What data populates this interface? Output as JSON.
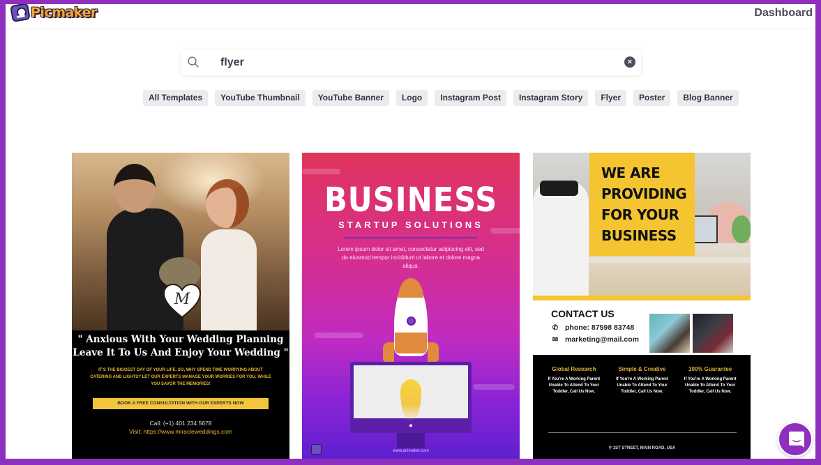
{
  "app": {
    "logo_text": "Picmaker",
    "frame_color": "#8e2fbf"
  },
  "header": {
    "dashboard_label": "Dashboard"
  },
  "search": {
    "value": "flyer",
    "placeholder": "",
    "clear_icon": "clear-circle-icon",
    "search_icon": "search-icon"
  },
  "categories": [
    {
      "label": "All Templates"
    },
    {
      "label": "YouTube Thumbnail"
    },
    {
      "label": "YouTube Banner"
    },
    {
      "label": "Logo"
    },
    {
      "label": "Instagram Post"
    },
    {
      "label": "Instagram Story"
    },
    {
      "label": "Flyer"
    },
    {
      "label": "Poster"
    },
    {
      "label": "Blog Banner"
    }
  ],
  "templates": [
    {
      "name": "wedding-planning-flyer",
      "monogram": "M",
      "quote_open": "\"",
      "quote_line1": "Anxious With Your Wedding Planning",
      "quote_line2": "Leave It To Us And Enjoy Your Wedding",
      "quote_close": "\"",
      "subtext": "It's the biggest day of your life. So, why spend time worrying about catering and lights? Let our experts manage your worries for you, while you savor the memories!",
      "cta": "BOOK A FREE CONSULTATION WITH OUR EXPERTS NOW",
      "call": "Call: (+1) 401 234 5678",
      "visit": "Visit: https://www.miracleweddings.com"
    },
    {
      "name": "business-startup-flyer",
      "title": "BUSINESS",
      "subtitle": "STARTUP SOLUTIONS",
      "body": "Lorem ipsum dolor sit amet, consectetur adipiscing elit, sed do eiusmod tempor incididunt ut labore et dolore magna aliqua.",
      "website": "www.animaker.com"
    },
    {
      "name": "business-contact-flyer",
      "headline": "WE ARE PROVIDING FOR YOUR BUSINESS",
      "contact_title": "CONTACT US",
      "phone": "phone: 87598 83748",
      "email": "marketing@mail.com",
      "features": [
        {
          "title": "Global Research",
          "body": "If You're A Working Parent Unable To Attend To Your Toddler, Call Us Now."
        },
        {
          "title": "Simple & Creative",
          "body": "If You're A Working Parent Unable To Attend To Your Toddler, Call Us Now."
        },
        {
          "title": "100% Guarantee",
          "body": "If You're A Working Parent Unable To Attend To Your Toddler, Call Us Now."
        }
      ],
      "address": "1ST STREET, MAIN ROAD, USA"
    }
  ],
  "chat": {
    "icon": "chat-icon"
  }
}
